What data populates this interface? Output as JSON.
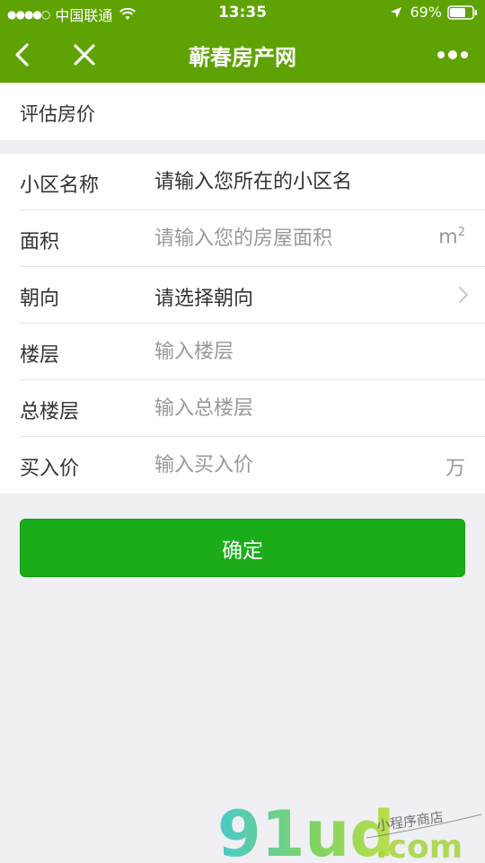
{
  "status_bar": {
    "signal": "●●●●○",
    "carrier": "中国联通",
    "time": "13:35",
    "battery": "69%"
  },
  "nav": {
    "title": "蕲春房产网",
    "icons": [
      "back-icon",
      "close-icon",
      "more-icon"
    ]
  },
  "section": {
    "title": "评估房价"
  },
  "form": {
    "community": {
      "label": "小区名称",
      "placeholder": "请输入您所在的小区名"
    },
    "area": {
      "label": "面积",
      "placeholder": "请输入您的房屋面积",
      "unit": "m",
      "unit_sup": "2"
    },
    "orientation": {
      "label": "朝向",
      "value": "请选择朝向"
    },
    "floor": {
      "label": "楼层",
      "placeholder": "输入楼层"
    },
    "total_floors": {
      "label": "总楼层",
      "placeholder": "输入总楼层"
    },
    "price": {
      "label": "买入价",
      "placeholder": "输入买入价",
      "unit": "万"
    }
  },
  "confirm_label": "确定",
  "watermark": {
    "brand": "91ud",
    "domain": ".com",
    "tagline": "小程序商店"
  },
  "colors": {
    "header_green": "#5ea303",
    "button_green": "#1aad19",
    "page_bg": "#efeff4"
  }
}
